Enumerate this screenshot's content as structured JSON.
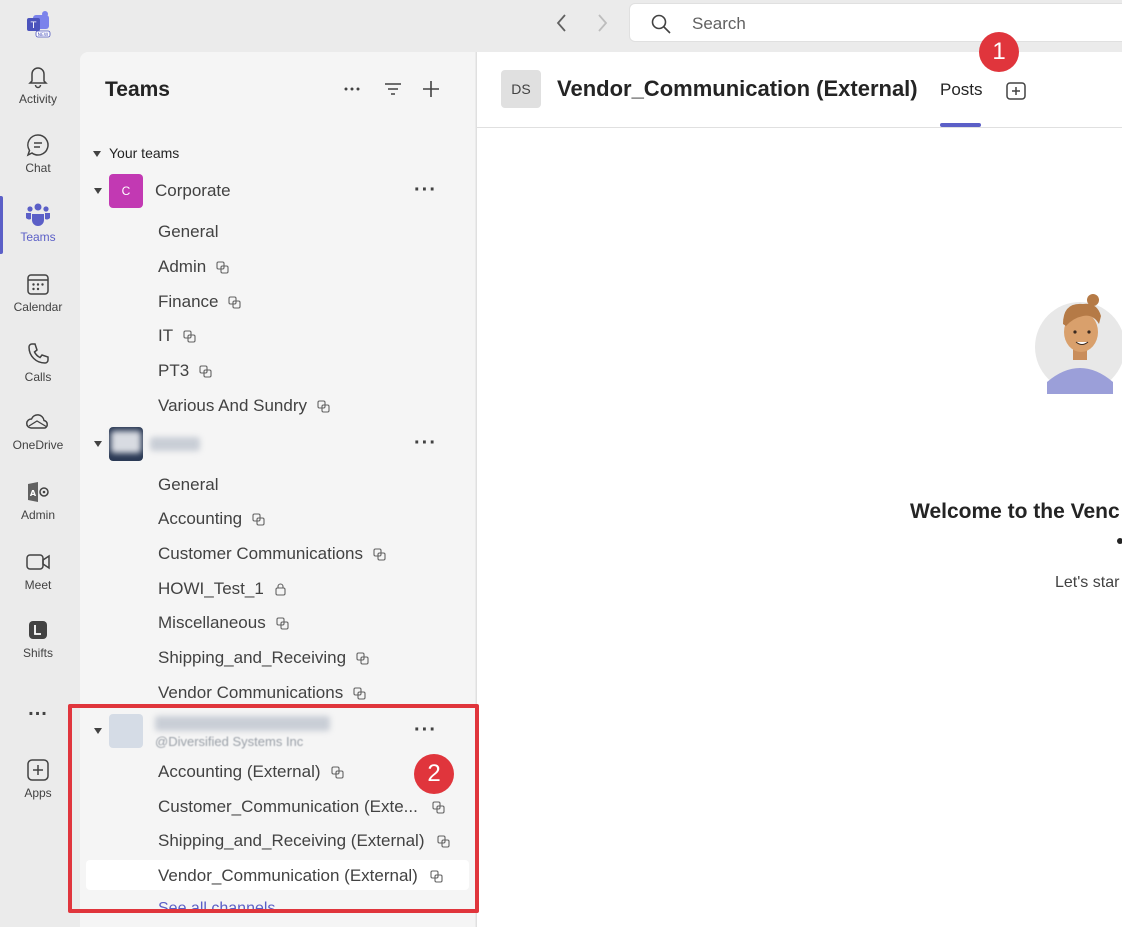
{
  "search": {
    "placeholder": "Search"
  },
  "rail": {
    "items": [
      {
        "label": "Activity",
        "icon": "bell-icon"
      },
      {
        "label": "Chat",
        "icon": "chat-icon"
      },
      {
        "label": "Teams",
        "icon": "teams-icon"
      },
      {
        "label": "Calendar",
        "icon": "calendar-icon"
      },
      {
        "label": "Calls",
        "icon": "phone-icon"
      },
      {
        "label": "OneDrive",
        "icon": "cloud-icon"
      },
      {
        "label": "Admin",
        "icon": "admin-icon"
      },
      {
        "label": "Meet",
        "icon": "video-icon"
      },
      {
        "label": "Shifts",
        "icon": "shifts-icon"
      },
      {
        "label": "...",
        "icon": "more-icon"
      },
      {
        "label": "Apps",
        "icon": "add-app-icon"
      }
    ],
    "active": "Teams",
    "accent": "#5b5fc7"
  },
  "panel": {
    "title": "Teams",
    "section": "Your teams",
    "teams": [
      {
        "avatar": "C",
        "avatar_color": "#c239b3",
        "name": "Corporate",
        "channels": [
          "General",
          "Admin",
          "Finance",
          "IT",
          "PT3",
          "Various And Sundry"
        ]
      },
      {
        "name": "",
        "channels": [
          "General",
          "Accounting",
          "Customer Communications",
          "HOWI_Test_1",
          "Miscellaneous",
          "Shipping_and_Receiving",
          "Vendor Communications"
        ]
      },
      {
        "name": "",
        "subtitle": "@Diversified Systems Inc",
        "channels": [
          "Accounting (External)",
          "Customer_Communication (Exte...",
          "Shipping_and_Receiving (External)",
          "Vendor_Communication (External)"
        ],
        "see_all": "See all channels"
      }
    ]
  },
  "main": {
    "avatar": "DS",
    "title": "Vendor_Communication (External)",
    "tab": "Posts",
    "welcome_title": "Welcome to the Venc",
    "welcome_sub": "Let's star"
  },
  "annotations": {
    "badge1": "1",
    "badge2": "2",
    "color": "#e0353c"
  }
}
